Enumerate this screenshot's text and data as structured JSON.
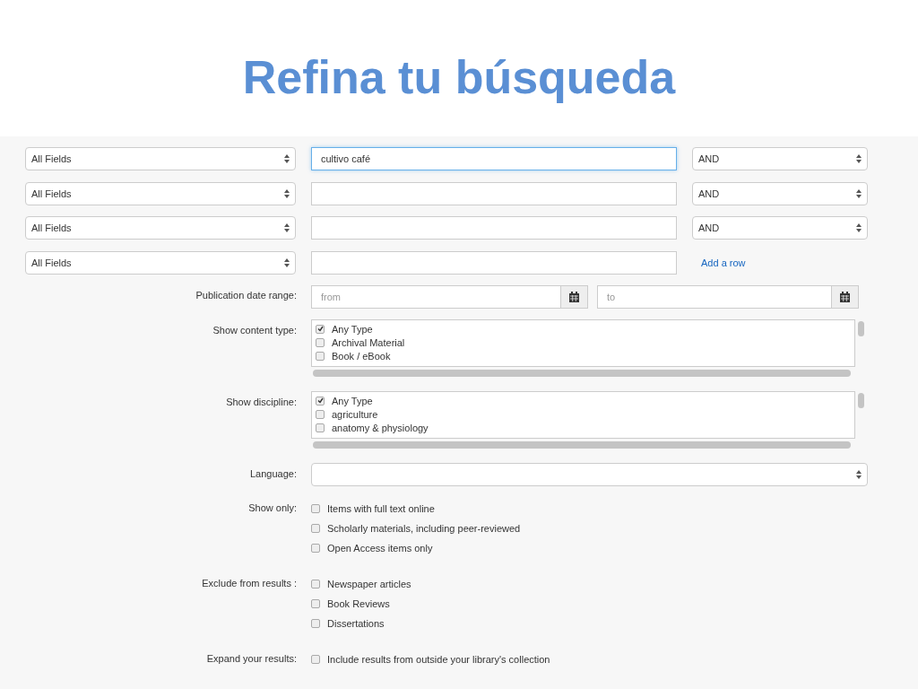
{
  "title": "Refina tu búsqueda",
  "search_rows": [
    {
      "field": "All Fields",
      "query": "cultivo café",
      "focused": true,
      "operator": "AND"
    },
    {
      "field": "All Fields",
      "focused": false,
      "operator": "AND"
    },
    {
      "field": "All Fields",
      "focused": false,
      "operator": "AND"
    },
    {
      "field": "All Fields",
      "focused": false
    }
  ],
  "add_row_link": "Add a row",
  "date_range": {
    "label": "Publication date range:",
    "from_placeholder": "from",
    "to_placeholder": "to"
  },
  "lists": [
    {
      "label": "Show content type:",
      "options": [
        {
          "label": "Any Type",
          "checked": true
        },
        {
          "label": "Archival Material",
          "checked": false
        },
        {
          "label": "Book / eBook",
          "checked": false
        }
      ]
    },
    {
      "label": "Show discipline:",
      "options": [
        {
          "label": "Any Type",
          "checked": true
        },
        {
          "label": "agriculture",
          "checked": false
        },
        {
          "label": "anatomy & physiology",
          "checked": false
        }
      ]
    }
  ],
  "language": {
    "label": "Language:"
  },
  "checkbox_groups": [
    {
      "label": "Show only:",
      "options": [
        {
          "label": "Items with full text online",
          "checked": false
        },
        {
          "label": "Scholarly materials, including peer-reviewed",
          "checked": false
        },
        {
          "label": "Open Access items only",
          "checked": false
        }
      ]
    },
    {
      "label": "Exclude from results :",
      "options": [
        {
          "label": "Newspaper articles",
          "checked": false
        },
        {
          "label": "Book Reviews",
          "checked": false
        },
        {
          "label": "Dissertations",
          "checked": false
        }
      ]
    },
    {
      "label": "Expand your results:",
      "options": [
        {
          "label": "Include results from outside your library's collection",
          "checked": false
        }
      ]
    }
  ]
}
